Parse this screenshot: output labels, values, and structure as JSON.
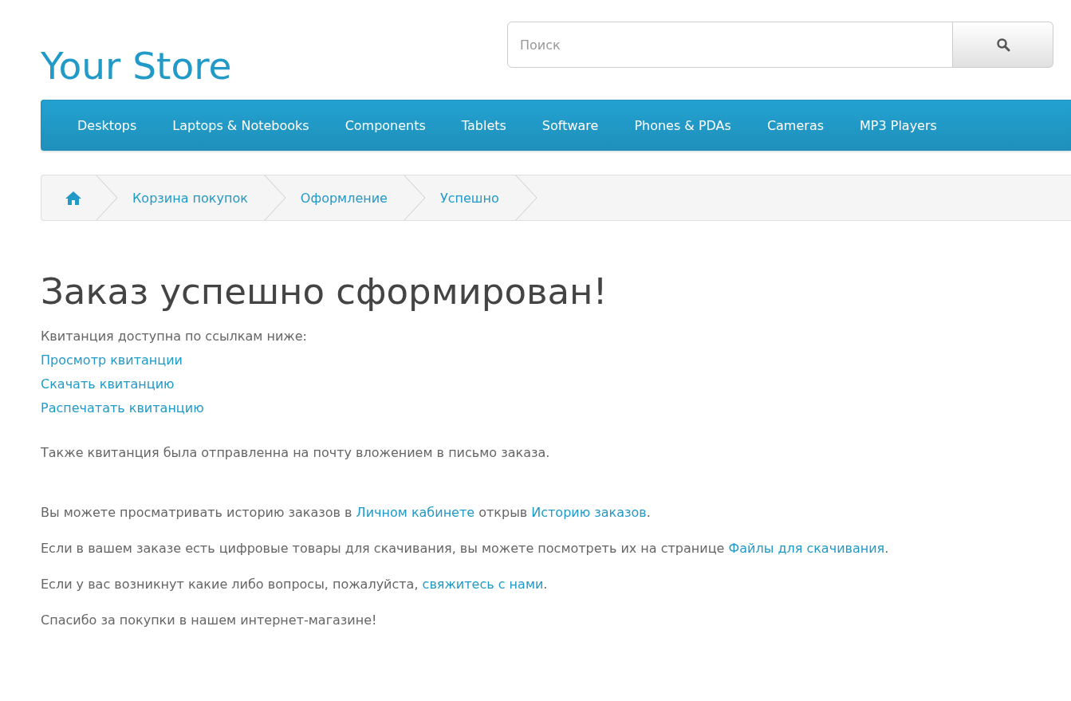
{
  "logo": "Your Store",
  "search": {
    "placeholder": "Поиск"
  },
  "menu": [
    "Desktops",
    "Laptops & Notebooks",
    "Components",
    "Tablets",
    "Software",
    "Phones & PDAs",
    "Cameras",
    "MP3 Players"
  ],
  "breadcrumb": [
    "Корзина покупок",
    "Оформление",
    "Успешно"
  ],
  "heading": "Заказ успешно сформирован!",
  "intro": "Квитанция доступна по ссылкам ниже:",
  "receipt_links": [
    "Просмотр квитанции",
    "Скачать квитанцию",
    "Распечатать квитанцию"
  ],
  "paragraphs": [
    [
      {
        "kind": "text",
        "text": "Также квитанция была отправленна на почту вложением в письмо заказа."
      }
    ],
    [
      {
        "kind": "text",
        "text": "Вы можете просматривать историю заказов в "
      },
      {
        "kind": "link",
        "text": "Личном кабинете"
      },
      {
        "kind": "text",
        "text": " открыв "
      },
      {
        "kind": "link",
        "text": "Историю заказов"
      },
      {
        "kind": "text",
        "text": "."
      }
    ],
    [
      {
        "kind": "text",
        "text": "Если в вашем заказе есть цифровые товары для скачивания, вы можете посмотреть их на странице "
      },
      {
        "kind": "link",
        "text": "Файлы для скачивания"
      },
      {
        "kind": "text",
        "text": "."
      }
    ],
    [
      {
        "kind": "text",
        "text": "Если у вас возникнут какие либо вопросы, пожалуйста, "
      },
      {
        "kind": "link",
        "text": "свяжитесь с нами"
      },
      {
        "kind": "text",
        "text": "."
      }
    ],
    [
      {
        "kind": "text",
        "text": "Спасибо за покупки в нашем интернет-магазине!"
      }
    ]
  ]
}
